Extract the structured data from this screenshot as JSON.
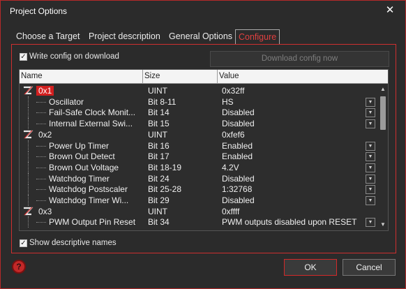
{
  "window": {
    "title": "Project Options",
    "close_label": "✕"
  },
  "tabs": [
    {
      "label": "Choose a Target"
    },
    {
      "label": "Project description"
    },
    {
      "label": "General Options"
    },
    {
      "label": "Configure"
    }
  ],
  "configure": {
    "write_config_label": "Write config on download",
    "write_config_checked": true,
    "download_button_label": "Download config now",
    "show_descriptive_label": "Show descriptive names",
    "show_descriptive_checked": true
  },
  "grid": {
    "columns": [
      "Name",
      "Size",
      "Value"
    ],
    "rows": [
      {
        "type": "group",
        "name": "0x1",
        "size": "UINT",
        "value": "0x32ff",
        "selected": true
      },
      {
        "type": "child",
        "name": "Oscillator",
        "size": "Bit 8-11",
        "value": "HS"
      },
      {
        "type": "child",
        "name": "Fail-Safe Clock Monit...",
        "size": "Bit 14",
        "value": "Disabled"
      },
      {
        "type": "child",
        "name": "Internal External Swi...",
        "size": "Bit 15",
        "value": "Disabled"
      },
      {
        "type": "group",
        "name": "0x2",
        "size": "UINT",
        "value": "0xfef6",
        "selected": false
      },
      {
        "type": "child",
        "name": "Power Up Timer",
        "size": "Bit 16",
        "value": "Enabled"
      },
      {
        "type": "child",
        "name": "Brown Out Detect",
        "size": "Bit 17",
        "value": "Enabled"
      },
      {
        "type": "child",
        "name": "Brown Out Voltage",
        "size": "Bit 18-19",
        "value": "4.2V"
      },
      {
        "type": "child",
        "name": "Watchdog Timer",
        "size": "Bit 24",
        "value": "Disabled"
      },
      {
        "type": "child",
        "name": "Watchdog Postscaler",
        "size": "Bit 25-28",
        "value": "1:32768"
      },
      {
        "type": "child",
        "name": "Watchdog Timer Wi...",
        "size": "Bit 29",
        "value": "Disabled"
      },
      {
        "type": "group",
        "name": "0x3",
        "size": "UINT",
        "value": "0xffff",
        "selected": false
      },
      {
        "type": "child",
        "name": "PWM Output Pin Reset",
        "size": "Bit 34",
        "value": "PWM outputs disabled upon RESET"
      }
    ]
  },
  "buttons": {
    "help_label": "?",
    "ok_label": "OK",
    "cancel_label": "Cancel"
  },
  "icons": {
    "group_icon": "z-chip-icon",
    "dropdown_icon": "chevron-down-icon"
  },
  "colors": {
    "accent": "#d21f1f",
    "background": "#2b2b2b"
  }
}
